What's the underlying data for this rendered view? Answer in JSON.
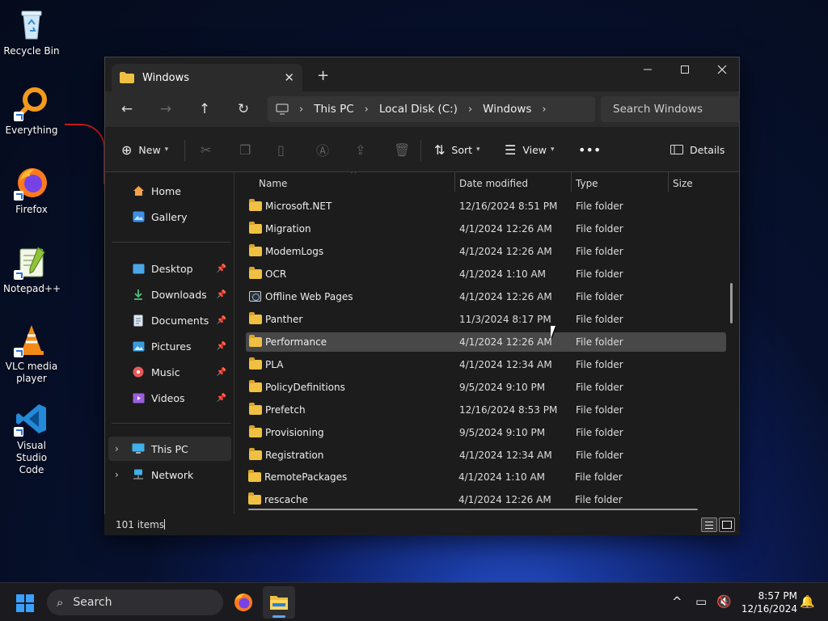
{
  "desktop": {
    "icons": [
      {
        "label": "Recycle Bin",
        "icon": "recycle-bin-icon"
      },
      {
        "label": "Everything",
        "icon": "everything-search-icon"
      },
      {
        "label": "Firefox",
        "icon": "firefox-icon"
      },
      {
        "label": "Notepad++",
        "icon": "notepad-plus-plus-icon"
      },
      {
        "label": "VLC media player",
        "icon": "vlc-icon"
      },
      {
        "label": "Visual Studio Code",
        "icon": "vscode-icon"
      }
    ]
  },
  "window": {
    "tab_title": "Windows",
    "address": {
      "segments": [
        "This PC",
        "Local Disk (C:)",
        "Windows"
      ]
    },
    "search_placeholder": "Search Windows",
    "commands": {
      "new": "New",
      "sort": "Sort",
      "view": "View",
      "details": "Details"
    },
    "sidebar": {
      "items": [
        {
          "label": "Home",
          "icon": "home-icon"
        },
        {
          "label": "Gallery",
          "icon": "gallery-icon"
        },
        {
          "label": "Desktop",
          "icon": "desktop-icon",
          "pinned": true
        },
        {
          "label": "Downloads",
          "icon": "downloads-icon",
          "pinned": true
        },
        {
          "label": "Documents",
          "icon": "documents-icon",
          "pinned": true
        },
        {
          "label": "Pictures",
          "icon": "pictures-icon",
          "pinned": true
        },
        {
          "label": "Music",
          "icon": "music-icon",
          "pinned": true
        },
        {
          "label": "Videos",
          "icon": "videos-icon",
          "pinned": true
        },
        {
          "label": "This PC",
          "icon": "this-pc-icon",
          "selected": true
        },
        {
          "label": "Network",
          "icon": "network-icon"
        }
      ]
    },
    "columns": {
      "name": "Name",
      "date": "Date modified",
      "type": "Type",
      "size": "Size"
    },
    "files": [
      {
        "name": "Microsoft.NET",
        "date": "12/16/2024 8:51 PM",
        "type": "File folder"
      },
      {
        "name": "Migration",
        "date": "4/1/2024 12:26 AM",
        "type": "File folder"
      },
      {
        "name": "ModemLogs",
        "date": "4/1/2024 12:26 AM",
        "type": "File folder"
      },
      {
        "name": "OCR",
        "date": "4/1/2024 1:10 AM",
        "type": "File folder"
      },
      {
        "name": "Offline Web Pages",
        "date": "4/1/2024 12:26 AM",
        "type": "File folder",
        "special_icon": true
      },
      {
        "name": "Panther",
        "date": "11/3/2024 8:17 PM",
        "type": "File folder"
      },
      {
        "name": "Performance",
        "date": "4/1/2024 12:26 AM",
        "type": "File folder",
        "hover": true
      },
      {
        "name": "PLA",
        "date": "4/1/2024 12:34 AM",
        "type": "File folder"
      },
      {
        "name": "PolicyDefinitions",
        "date": "9/5/2024 9:10 PM",
        "type": "File folder"
      },
      {
        "name": "Prefetch",
        "date": "12/16/2024 8:53 PM",
        "type": "File folder"
      },
      {
        "name": "Provisioning",
        "date": "9/5/2024 9:10 PM",
        "type": "File folder"
      },
      {
        "name": "Registration",
        "date": "4/1/2024 12:34 AM",
        "type": "File folder"
      },
      {
        "name": "RemotePackages",
        "date": "4/1/2024 1:10 AM",
        "type": "File folder"
      },
      {
        "name": "rescache",
        "date": "4/1/2024 12:26 AM",
        "type": "File folder"
      }
    ],
    "status": {
      "item_count": "101 items"
    }
  },
  "taskbar": {
    "search_label": "Search",
    "time": "8:57 PM",
    "date": "12/16/2024"
  },
  "colors": {
    "folder": "#f0c042",
    "accent": "#3aa0ff",
    "hover_row": "#484848"
  }
}
